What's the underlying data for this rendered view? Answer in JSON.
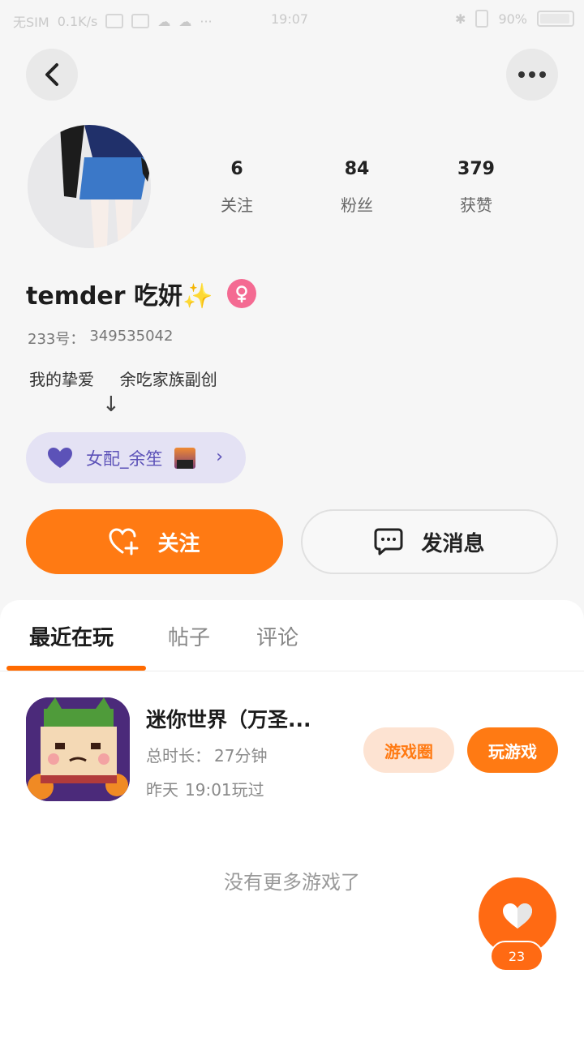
{
  "status_bar": {
    "carrier": "无SIM",
    "speed": "0.1K/s",
    "time": "19:07",
    "battery": "90%"
  },
  "profile": {
    "username": "temder 吃妍✨",
    "uid_label": "233号：",
    "uid_value": "349535042",
    "bio_line": "我的挚爱     余吃家族副创",
    "arrow": "↓",
    "relation_label": "女配_余笙",
    "stats": [
      {
        "num": "6",
        "label": "关注"
      },
      {
        "num": "84",
        "label": "粉丝"
      },
      {
        "num": "379",
        "label": "获赞"
      }
    ]
  },
  "actions": {
    "follow_label": "关注",
    "message_label": "发消息"
  },
  "tabs": [
    {
      "label": "最近在玩",
      "active": true
    },
    {
      "label": "帖子",
      "active": false
    },
    {
      "label": "评论",
      "active": false
    }
  ],
  "game": {
    "title": "迷你世界（万圣...",
    "duration_label": "总时长：",
    "duration_value": "27分钟",
    "last_played_day": "昨天",
    "last_played_time": "19:01玩过",
    "circle_button": "游戏圈",
    "play_button": "玩游戏"
  },
  "empty_text": "没有更多游戏了",
  "like": {
    "count": "23"
  },
  "colors": {
    "accent": "#ff7a13",
    "relation_bg": "#e4e2f4",
    "relation_text": "#5c52b8",
    "female_badge": "#f46a92"
  }
}
